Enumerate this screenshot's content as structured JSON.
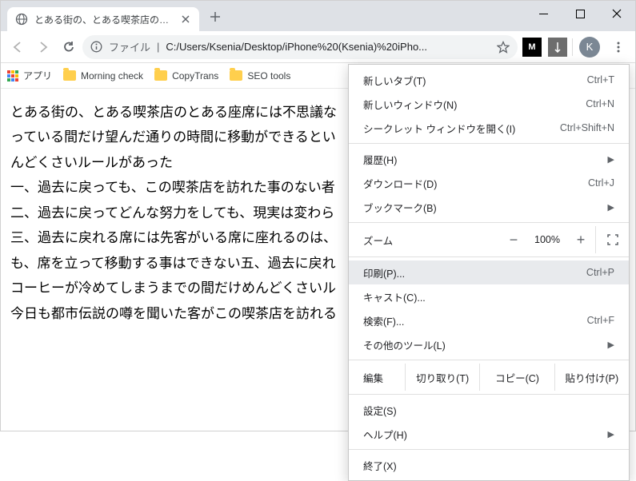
{
  "tab": {
    "title": "とある街の、とある喫茶店のとある座",
    "close_tooltip": "Close"
  },
  "window_controls": {
    "minimize": "Minimize",
    "maximize": "Maximize",
    "close": "Close"
  },
  "toolbar": {
    "file_label": "ファイル",
    "url": "C:/Users/Ksenia/Desktop/iPhone%20(Ksenia)%20iPho...",
    "avatar_initial": "K"
  },
  "bookmarks": {
    "apps": "アプリ",
    "items": [
      "Morning check",
      "CopyTrans",
      "SEO tools"
    ]
  },
  "content": {
    "lines": [
      "とある街の、とある喫茶店のとある座席には不思議な",
      "っている間だけ望んだ通りの時間に移動ができるとい",
      "んどくさいルールがあった",
      "一、過去に戻っても、この喫茶店を訪れた事のない者",
      "二、過去に戻ってどんな努力をしても、現実は変わら",
      "三、過去に戻れる席には先客がいる席に座れるのは、",
      "も、席を立って移動する事はできない五、過去に戻れ",
      "コーヒーが冷めてしまうまでの間だけめんどくさいル",
      "今日も都市伝説の噂を聞いた客がこの喫茶店を訪れる"
    ]
  },
  "menu": {
    "new_tab": {
      "label": "新しいタブ(T)",
      "shortcut": "Ctrl+T"
    },
    "new_window": {
      "label": "新しいウィンドウ(N)",
      "shortcut": "Ctrl+N"
    },
    "incognito": {
      "label": "シークレット ウィンドウを開く(I)",
      "shortcut": "Ctrl+Shift+N"
    },
    "history": {
      "label": "履歴(H)"
    },
    "downloads": {
      "label": "ダウンロード(D)",
      "shortcut": "Ctrl+J"
    },
    "bookmarks": {
      "label": "ブックマーク(B)"
    },
    "zoom_label": "ズーム",
    "zoom_value": "100%",
    "print": {
      "label": "印刷(P)...",
      "shortcut": "Ctrl+P"
    },
    "cast": {
      "label": "キャスト(C)..."
    },
    "find": {
      "label": "検索(F)...",
      "shortcut": "Ctrl+F"
    },
    "more_tools": {
      "label": "その他のツール(L)"
    },
    "edit_label": "編集",
    "cut": "切り取り(T)",
    "copy": "コピー(C)",
    "paste": "貼り付け(P)",
    "settings": {
      "label": "設定(S)"
    },
    "help": {
      "label": "ヘルプ(H)"
    },
    "exit": {
      "label": "終了(X)"
    }
  }
}
